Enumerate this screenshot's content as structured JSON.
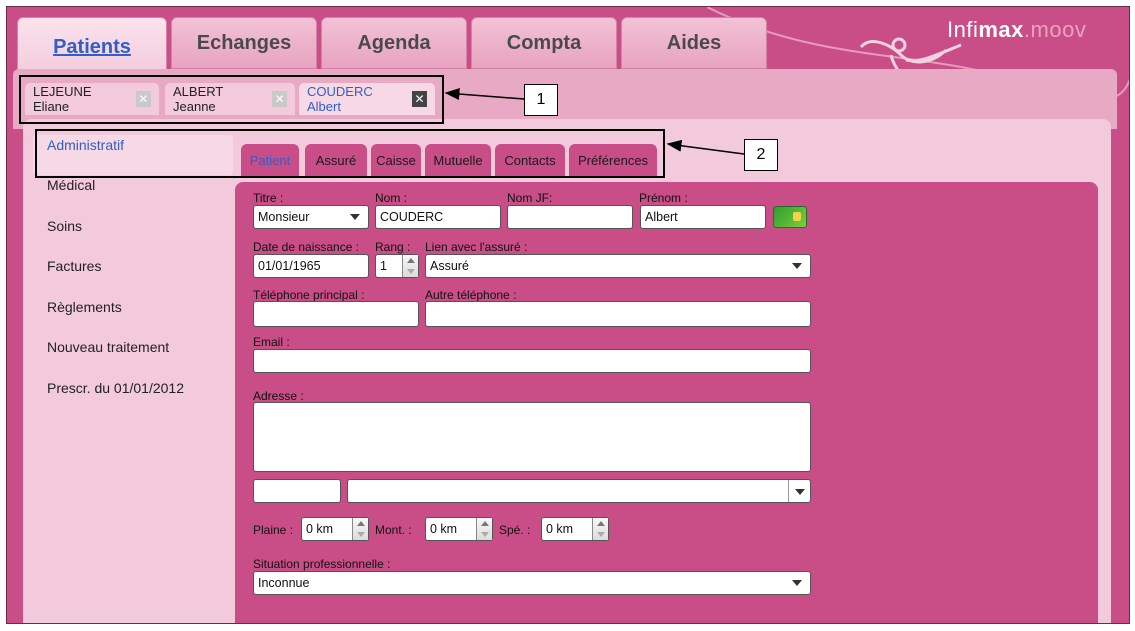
{
  "top_tabs": [
    "Patients",
    "Echanges",
    "Agenda",
    "Compta",
    "Aides"
  ],
  "logo": {
    "light": "Infi",
    "bold": "max",
    "suffix": ".moov"
  },
  "doc_tabs": [
    "LEJEUNE Eliane",
    "ALBERT Jeanne",
    "COUDERC Albert"
  ],
  "close_glyph": "✕",
  "sidebar": [
    "Administratif",
    "Médical",
    "Soins",
    "Factures",
    "Règlements",
    "Nouveau traitement",
    "Prescr. du 01/01/2012"
  ],
  "sub_tabs": [
    "Patient",
    "Assuré",
    "Caisse",
    "Mutuelle",
    "Contacts",
    "Préférences"
  ],
  "form": {
    "titre_label": "Titre :",
    "titre_value": "Monsieur",
    "nom_label": "Nom :",
    "nom_value": "COUDERC",
    "nomjf_label": "Nom JF:",
    "nomjf_value": "",
    "prenom_label": "Prénom :",
    "prenom_value": "Albert",
    "naissance_label": "Date de naissance :",
    "naissance_value": "01/01/1965",
    "rang_label": "Rang :",
    "rang_value": "1",
    "lien_label": "Lien avec l'assuré :",
    "lien_value": "Assuré",
    "tel_label": "Téléphone principal :",
    "tel_value": "",
    "autre_tel_label": "Autre téléphone :",
    "autre_tel_value": "",
    "email_label": "Email :",
    "email_value": "",
    "adresse_label": "Adresse :",
    "adresse_value": "",
    "plaine_label": "Plaine :",
    "plaine_value": "0 km",
    "mont_label": "Mont. :",
    "mont_value": "0 km",
    "spe_label": "Spé. :",
    "spe_value": "0 km",
    "situation_label": "Situation professionnelle :",
    "situation_value": "Inconnue"
  },
  "callouts": [
    "1",
    "2"
  ]
}
